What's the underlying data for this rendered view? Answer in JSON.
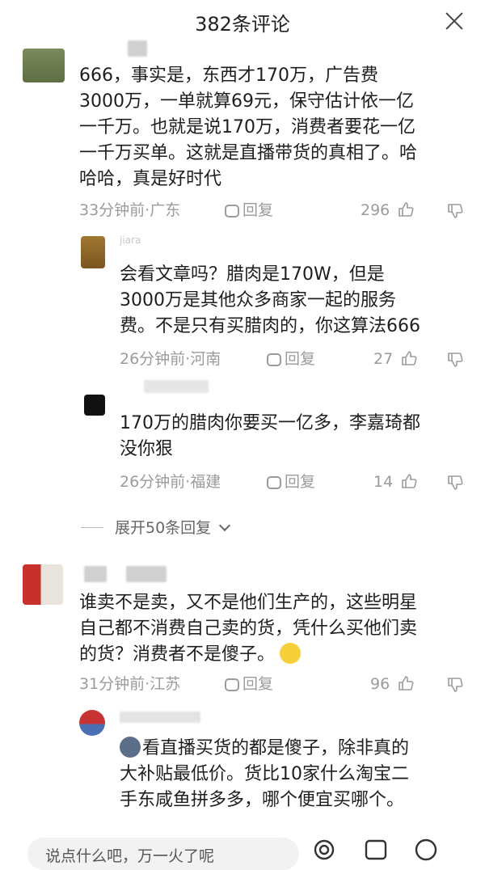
{
  "header": {
    "title": "382条评论"
  },
  "comments": [
    {
      "text": "666，事实是，东西才170万，广告费3000万，一单就算69元，保守估计依一亿一千万。也就是说170万，消费者要花一亿一千万买单。这就是直播带货的真相了。哈哈哈，真是好时代",
      "lines": [
        "666，事实是，东西才170万，广告费",
        "3000万，一单就算69元，保守估计依一亿",
        "一千万。也就是说170万，消费者要花一亿",
        "一千万买单。这就是直播带货的真相了。哈",
        "哈哈，真是好时代"
      ],
      "time": "33分钟前·广东",
      "reply": "回复",
      "likes": "296"
    },
    {
      "name_fragment": "jiara",
      "lines": [
        "会看文章吗？腊肉是170W，但是",
        "3000万是其他众多商家一起的服务",
        "费。不是只有买腊肉的，你这算法666"
      ],
      "time": "26分钟前·河南",
      "reply": "回复",
      "likes": "27"
    },
    {
      "lines": [
        "170万的腊肉你要买一亿多，李嘉琦都",
        "没你狠"
      ],
      "time": "26分钟前·福建",
      "reply": "回复",
      "likes": "14"
    },
    {
      "lines": [
        "谁卖不是卖，又不是他们生产的，这些明星",
        "自己都不消费自己卖的货，凭什么买他们卖",
        "的货？消费者不是傻子。"
      ],
      "time": "31分钟前·江苏",
      "reply": "回复",
      "likes": "96"
    },
    {
      "lines": [
        "看直播买货的都是傻子，除非真的",
        "大补贴最低价。货比10家什么淘宝二",
        "手东咸鱼拼多多，哪个便宜买哪个。"
      ]
    }
  ],
  "expand_replies": "展开50条回复",
  "input": {
    "placeholder": "说点什么吧，万一火了呢"
  },
  "icons": {
    "close": "close-icon",
    "reply": "comment-bubble-icon",
    "like": "thumbs-up-icon",
    "dislike": "thumbs-down-icon",
    "smile": "smile-emoji-icon",
    "mention": "at-icon",
    "image": "image-icon",
    "emoji": "emoji-icon"
  },
  "colors": {
    "text": "#1e1e1e",
    "meta": "#9b9b9b",
    "background": "#ffffff"
  }
}
